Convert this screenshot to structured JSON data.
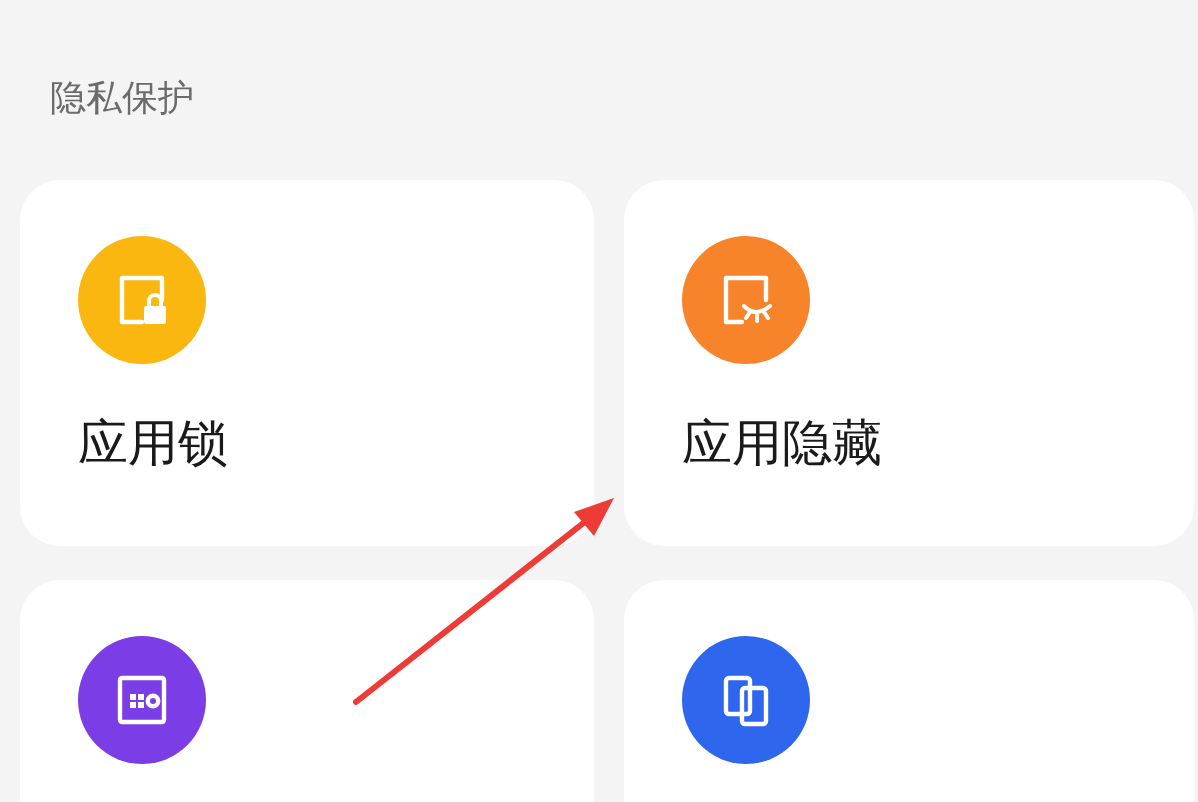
{
  "section_title": "隐私保护",
  "cards": [
    {
      "kind": "lock",
      "color": "#f9b70f",
      "label": "应用锁"
    },
    {
      "kind": "hide",
      "color": "#f7842a",
      "label": "应用隐藏"
    },
    {
      "kind": "safe",
      "color": "#7b3ee6"
    },
    {
      "kind": "dual",
      "color": "#2f66ee"
    }
  ]
}
